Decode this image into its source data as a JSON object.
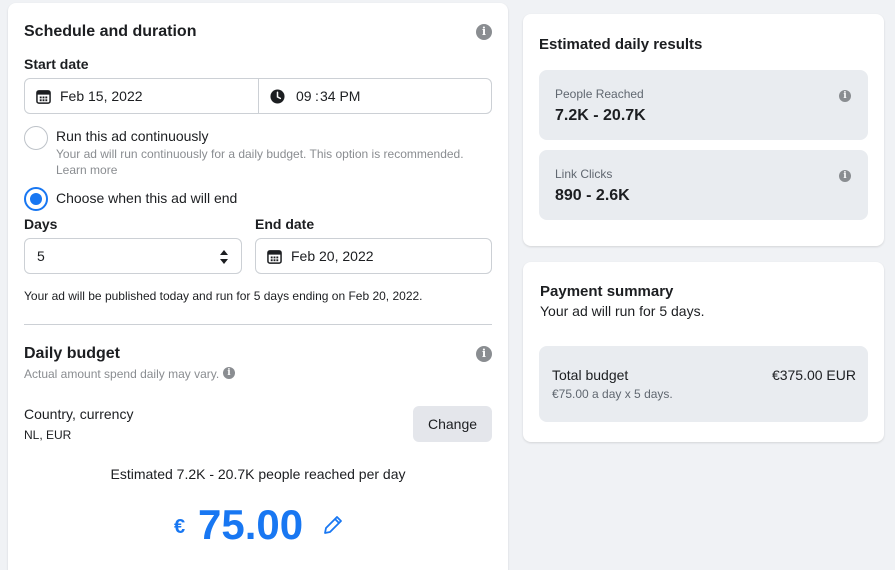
{
  "schedule": {
    "title": "Schedule and duration",
    "start_date_label": "Start date",
    "start_date_value": "Feb 15, 2022",
    "start_time_hour": "09",
    "start_time_sep": ":",
    "start_time_min": "34 PM",
    "option_continuous": "Run this ad continuously",
    "option_continuous_desc": "Your ad will run continuously for a daily budget. This option is recommended.",
    "learn_more": "Learn more",
    "option_end": "Choose when this ad will end",
    "days_label": "Days",
    "days_value": "5",
    "end_date_label": "End date",
    "end_date_value": "Feb 20, 2022",
    "publish_note": "Your ad will be published today and run for 5 days ending on Feb 20, 2022."
  },
  "budget": {
    "title": "Daily budget",
    "subtitle": "Actual amount spend daily may vary.",
    "country_label": "Country, currency",
    "country_value": "NL, EUR",
    "change_button": "Change",
    "estimate": "Estimated 7.2K - 20.7K people reached per day",
    "currency_symbol": "€",
    "amount": "75.00"
  },
  "results": {
    "title": "Estimated daily results",
    "people_label": "People Reached",
    "people_value": "7.2K - 20.7K",
    "clicks_label": "Link Clicks",
    "clicks_value": "890 - 2.6K"
  },
  "payment": {
    "title": "Payment summary",
    "subtitle": "Your ad will run for 5 days.",
    "total_label": "Total budget",
    "total_value": "€375.00 EUR",
    "total_detail": "€75.00 a day x 5 days."
  },
  "colors": {
    "accent": "#1877f2",
    "background": "#f0f2f5",
    "panel": "#e9ecf0"
  }
}
